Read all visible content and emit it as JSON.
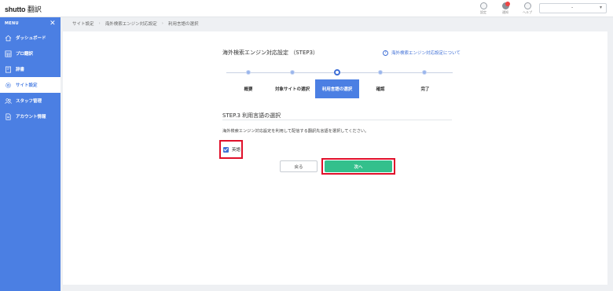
{
  "app": {
    "logo_main": "shutto",
    "logo_sub": "翻訳"
  },
  "top_icons": [
    {
      "label": "設定",
      "icon": "settings-icon"
    },
    {
      "label": "通知",
      "icon": "notification-icon"
    },
    {
      "label": "ヘルプ",
      "icon": "help-icon"
    }
  ],
  "user_select": {
    "value": "-",
    "caret": "▾"
  },
  "sidebar": {
    "menu_label": "MENU",
    "close": "✕",
    "items": [
      {
        "label": "ダッシュボード",
        "icon": "home-icon"
      },
      {
        "label": "プロ翻訳",
        "icon": "grid-icon"
      },
      {
        "label": "辞書",
        "icon": "book-icon"
      },
      {
        "label": "サイト設定",
        "icon": "gear-icon"
      },
      {
        "label": "スタッフ管理",
        "icon": "users-icon"
      },
      {
        "label": "アカウント情報",
        "icon": "document-icon"
      }
    ]
  },
  "breadcrumb": [
    "サイト設定",
    "海外検索エンジン対応設定",
    "利用言語の選択"
  ],
  "page": {
    "title": "海外検索エンジン対応設定 （STEP3）",
    "help_link": "海外検索エンジン対応設定について",
    "steps": [
      "概要",
      "対象サイトの選択",
      "利用言語の選択",
      "確認",
      "完了"
    ],
    "current_step": 3,
    "section_title": "STEP.3 利用言語の選択",
    "description": "海外検索エンジン対応設定を利用して配信する翻訳先言語を選択してください。",
    "language_option": {
      "label": "英語",
      "checked": true
    },
    "back_button": "戻る",
    "next_button": "次へ"
  },
  "colors": {
    "sidebar": "#4b7fe3",
    "accent": "#3f6fd6",
    "primary_button": "#33c08c",
    "highlight_border": "#e0102a"
  }
}
